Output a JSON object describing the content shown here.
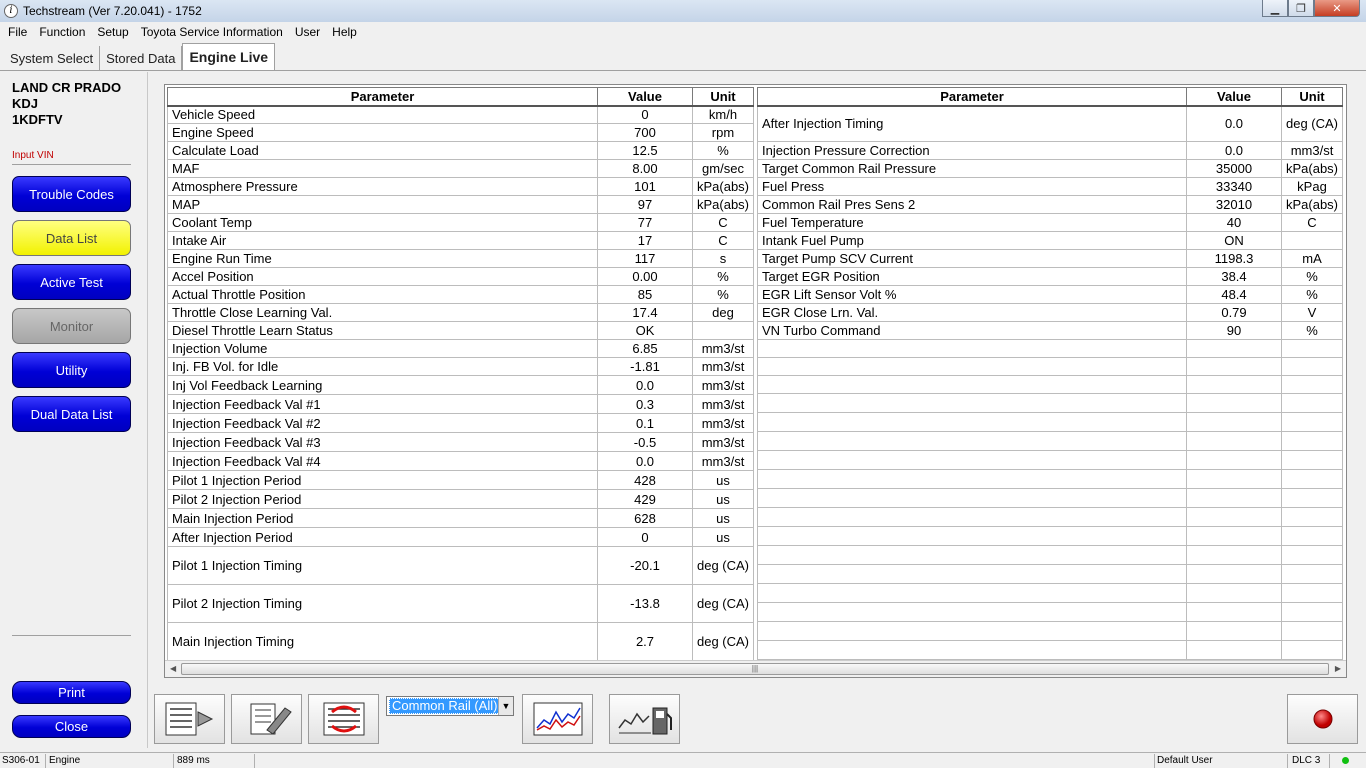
{
  "window": {
    "title": "Techstream (Ver 7.20.041) - 1752",
    "app_icon": "info-icon"
  },
  "menu": [
    "File",
    "Function",
    "Setup",
    "Toyota Service Information",
    "User",
    "Help"
  ],
  "tabs": [
    {
      "label": "System Select",
      "active": false
    },
    {
      "label": "Stored Data",
      "active": false
    },
    {
      "label": "Engine Live",
      "active": true
    }
  ],
  "vehicle": {
    "model": "LAND CR PRADO",
    "chassis": "KDJ",
    "engine": "1KDFTV",
    "input_vin": "Input VIN"
  },
  "nav": {
    "trouble_codes": "Trouble Codes",
    "data_list": "Data List",
    "active_test": "Active Test",
    "monitor": "Monitor",
    "utility": "Utility",
    "dual_data_list": "Dual Data List",
    "print": "Print",
    "close": "Close"
  },
  "table": {
    "headers": {
      "parameter": "Parameter",
      "value": "Value",
      "unit": "Unit"
    },
    "left": [
      {
        "p": "Vehicle Speed",
        "v": "0",
        "u": "km/h"
      },
      {
        "p": "Engine Speed",
        "v": "700",
        "u": "rpm"
      },
      {
        "p": "Calculate Load",
        "v": "12.5",
        "u": "%"
      },
      {
        "p": "MAF",
        "v": "8.00",
        "u": "gm/sec"
      },
      {
        "p": "Atmosphere Pressure",
        "v": "101",
        "u": "kPa(abs)"
      },
      {
        "p": "MAP",
        "v": "97",
        "u": "kPa(abs)"
      },
      {
        "p": "Coolant Temp",
        "v": "77",
        "u": "C"
      },
      {
        "p": "Intake Air",
        "v": "17",
        "u": "C"
      },
      {
        "p": "Engine Run Time",
        "v": "117",
        "u": "s"
      },
      {
        "p": "Accel Position",
        "v": "0.00",
        "u": "%"
      },
      {
        "p": "Actual Throttle Position",
        "v": "85",
        "u": "%"
      },
      {
        "p": "Throttle Close Learning Val.",
        "v": "17.4",
        "u": "deg"
      },
      {
        "p": "Diesel Throttle Learn Status",
        "v": "OK",
        "u": ""
      },
      {
        "p": "Injection Volume",
        "v": "6.85",
        "u": "mm3/st"
      },
      {
        "p": "Inj. FB Vol. for Idle",
        "v": "-1.81",
        "u": "mm3/st"
      },
      {
        "p": "Inj Vol Feedback Learning",
        "v": "0.0",
        "u": "mm3/st"
      },
      {
        "p": "Injection Feedback Val #1",
        "v": "0.3",
        "u": "mm3/st"
      },
      {
        "p": "Injection Feedback Val #2",
        "v": "0.1",
        "u": "mm3/st"
      },
      {
        "p": "Injection Feedback Val #3",
        "v": "-0.5",
        "u": "mm3/st"
      },
      {
        "p": "Injection Feedback Val #4",
        "v": "0.0",
        "u": "mm3/st"
      },
      {
        "p": "Pilot 1 Injection Period",
        "v": "428",
        "u": "us"
      },
      {
        "p": "Pilot 2 Injection Period",
        "v": "429",
        "u": "us"
      },
      {
        "p": "Main Injection Period",
        "v": "628",
        "u": "us"
      },
      {
        "p": "After Injection Period",
        "v": "0",
        "u": "us"
      },
      {
        "p": "Pilot 1 Injection Timing",
        "v": "-20.1",
        "u": "deg (CA)"
      },
      {
        "p": "Pilot 2 Injection Timing",
        "v": "-13.8",
        "u": "deg (CA)"
      },
      {
        "p": "Main Injection Timing",
        "v": "2.7",
        "u": "deg (CA)"
      }
    ],
    "right": [
      {
        "p": "After Injection Timing",
        "v": "0.0",
        "u": "deg (CA)"
      },
      {
        "p": "Injection Pressure Correction",
        "v": "0.0",
        "u": "mm3/st"
      },
      {
        "p": "Target Common Rail Pressure",
        "v": "35000",
        "u": "kPa(abs)"
      },
      {
        "p": "Fuel Press",
        "v": "33340",
        "u": "kPag"
      },
      {
        "p": "Common Rail Pres Sens 2",
        "v": "32010",
        "u": "kPa(abs)"
      },
      {
        "p": "Fuel Temperature",
        "v": "40",
        "u": "C"
      },
      {
        "p": "Intank Fuel Pump",
        "v": "ON",
        "u": ""
      },
      {
        "p": "Target Pump SCV Current",
        "v": "1198.3",
        "u": "mA"
      },
      {
        "p": "Target EGR Position",
        "v": "38.4",
        "u": "%"
      },
      {
        "p": "EGR Lift Sensor Volt %",
        "v": "48.4",
        "u": "%"
      },
      {
        "p": "EGR Close Lrn. Val.",
        "v": "0.79",
        "u": "V"
      },
      {
        "p": "VN Turbo Command",
        "v": "90",
        "u": "%"
      }
    ]
  },
  "toolbar": {
    "group_select": "Common Rail (All)",
    "icons": [
      "list-icon",
      "manual-icon",
      "swap-list-icon",
      "graph-icon",
      "fuel-graph-icon",
      "record-icon"
    ]
  },
  "status": {
    "code": "S306-01",
    "system": "Engine",
    "timing": "889 ms",
    "user": "Default User",
    "connection": "DLC 3"
  },
  "colors": {
    "nav_blue": "#0000d6",
    "nav_yellow": "#f2f200",
    "nav_gray": "#a6a6a6",
    "status_green": "#10c010",
    "record_red": "#d00000",
    "selection": "#3399ff"
  }
}
